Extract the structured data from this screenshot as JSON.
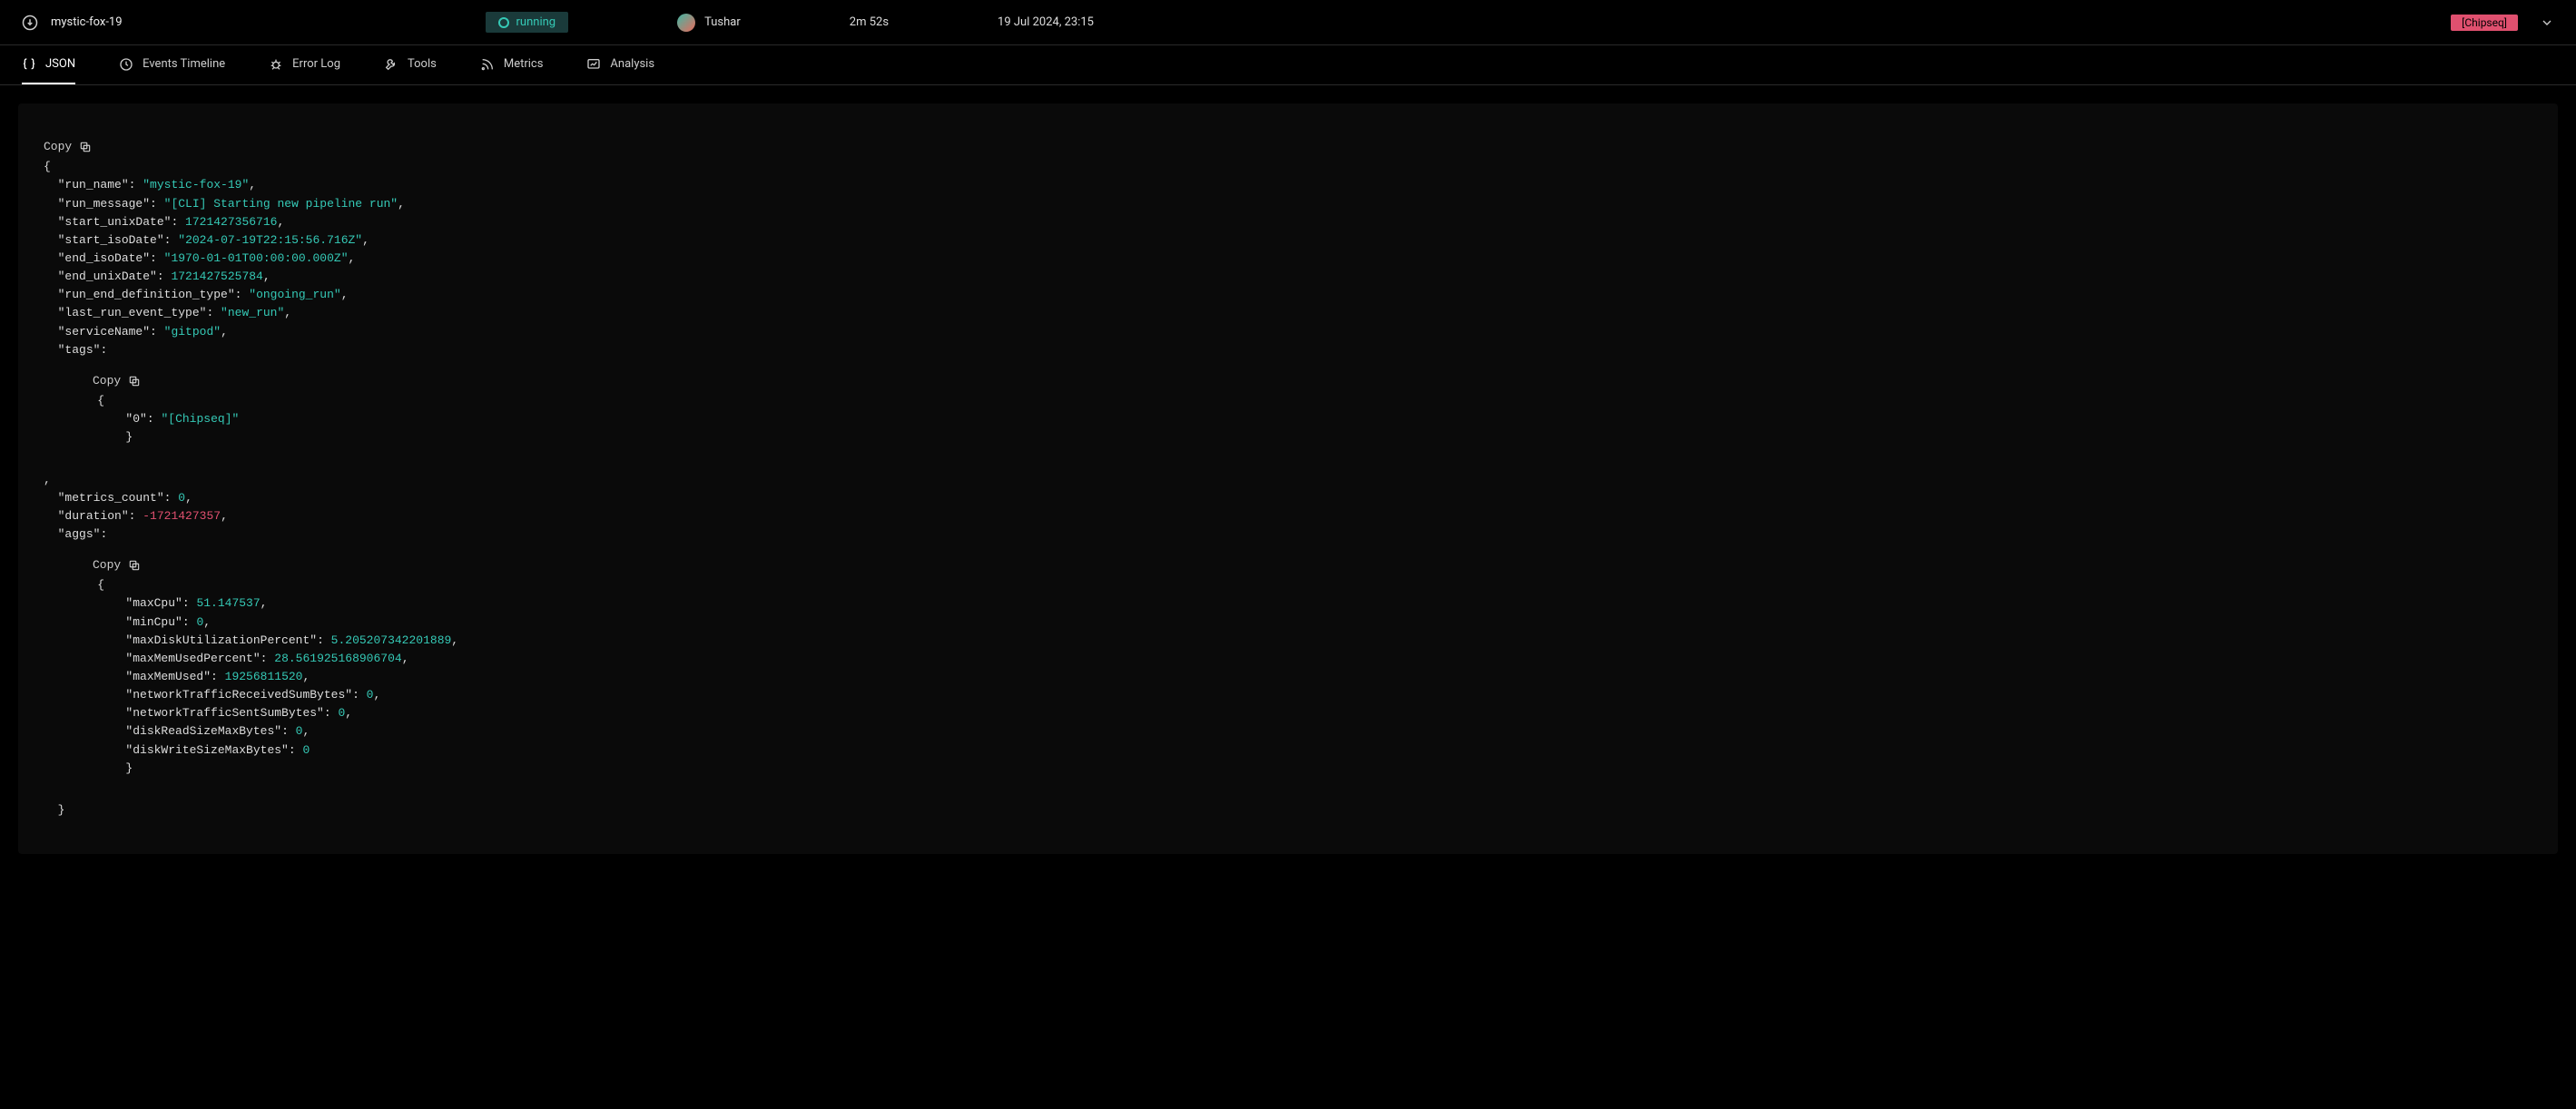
{
  "header": {
    "run_name": "mystic-fox-19",
    "status_label": "running",
    "user_name": "Tushar",
    "duration": "2m 52s",
    "timestamp": "19 Jul 2024, 23:15",
    "tag": "[Chipseq]"
  },
  "tabs": [
    {
      "label": "JSON"
    },
    {
      "label": "Events Timeline"
    },
    {
      "label": "Error Log"
    },
    {
      "label": "Tools"
    },
    {
      "label": "Metrics"
    },
    {
      "label": "Analysis"
    }
  ],
  "copy_label": "Copy",
  "json": {
    "run_name": "mystic-fox-19",
    "run_message": "[CLI] Starting new pipeline run",
    "start_unixDate": "1721427356716",
    "start_isoDate": "2024-07-19T22:15:56.716Z",
    "end_isoDate": "1970-01-01T00:00:00.000Z",
    "end_unixDate": "1721427525784",
    "run_end_definition_type": "ongoing_run",
    "last_run_event_type": "new_run",
    "serviceName": "gitpod",
    "tags_key": "tags",
    "tags": {
      "0_key": "0",
      "0_val": "[Chipseq]"
    },
    "metrics_count": "0",
    "duration": "-1721427357",
    "aggs_key": "aggs",
    "aggs": {
      "maxCpu": "51.147537",
      "minCpu": "0",
      "maxDiskUtilizationPercent": "5.205207342201889",
      "maxMemUsedPercent": "28.561925168906704",
      "maxMemUsed": "19256811520",
      "networkTrafficReceivedSumBytes": "0",
      "networkTrafficSentSumBytes": "0",
      "diskReadSizeMaxBytes": "0",
      "diskWriteSizeMaxBytes": "0"
    }
  }
}
